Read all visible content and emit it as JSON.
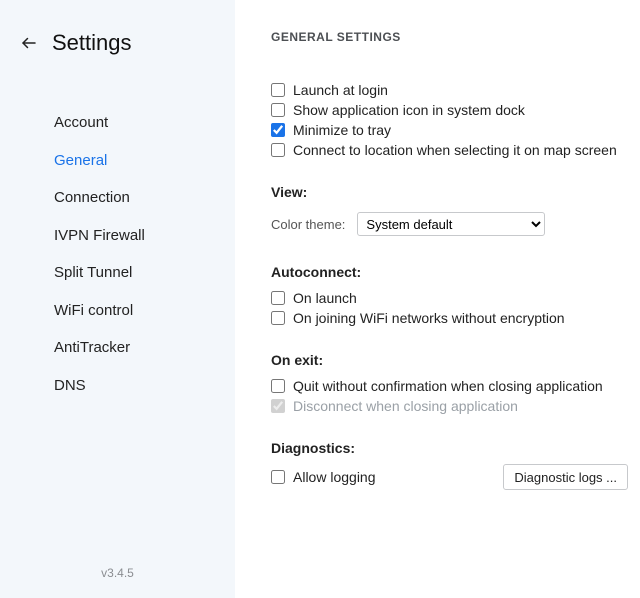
{
  "sidebar": {
    "title": "Settings",
    "items": [
      {
        "label": "Account"
      },
      {
        "label": "General"
      },
      {
        "label": "Connection"
      },
      {
        "label": "IVPN Firewall"
      },
      {
        "label": "Split Tunnel"
      },
      {
        "label": "WiFi control"
      },
      {
        "label": "AntiTracker"
      },
      {
        "label": "DNS"
      }
    ],
    "active_index": 1,
    "version": "v3.4.5"
  },
  "main": {
    "heading": "GENERAL SETTINGS",
    "general": {
      "launch_at_login": "Launch at login",
      "show_dock_icon": "Show application icon in system dock",
      "minimize_to_tray": "Minimize to tray",
      "connect_on_map": "Connect to location when selecting it on map screen"
    },
    "view": {
      "subhead": "View:",
      "color_theme_label": "Color theme:",
      "color_theme_value": "System default"
    },
    "autoconnect": {
      "subhead": "Autoconnect:",
      "on_launch": "On launch",
      "on_join_open_wifi": "On joining WiFi networks without encryption"
    },
    "on_exit": {
      "subhead": "On exit:",
      "quit_no_confirm": "Quit without confirmation when closing application",
      "disconnect_on_close": "Disconnect when closing application"
    },
    "diagnostics": {
      "subhead": "Diagnostics:",
      "allow_logging": "Allow logging",
      "diag_logs_btn": "Diagnostic logs ..."
    },
    "checked": {
      "launch_at_login": false,
      "show_dock_icon": false,
      "minimize_to_tray": true,
      "connect_on_map": false,
      "on_launch": false,
      "on_join_open_wifi": false,
      "quit_no_confirm": false,
      "disconnect_on_close": true,
      "allow_logging": false
    }
  }
}
